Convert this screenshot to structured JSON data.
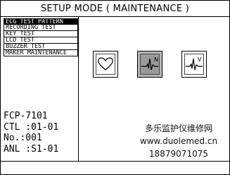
{
  "title": "SETUP MODE ( MAINTENANCE )",
  "menu": {
    "items": [
      {
        "label": "ECG TEST PATTERN",
        "selected": true
      },
      {
        "label": "RECORDING TEST",
        "selected": false
      },
      {
        "label": "KEY TEST",
        "selected": false
      },
      {
        "label": "LCD TEST",
        "selected": false
      },
      {
        "label": "BUZZER TEST",
        "selected": false
      },
      {
        "label": "MAKER MAINTENANCE",
        "selected": false
      }
    ]
  },
  "info": {
    "model": "FCP-7101",
    "ctl": "CTL :01-01",
    "no": "No.:001",
    "anl": "ANL :S1-01"
  },
  "icons": [
    {
      "name": "heart-icon",
      "tag": "",
      "active": false
    },
    {
      "name": "ecg-normal-icon",
      "tag": "N",
      "active": true
    },
    {
      "name": "ecg-v-icon",
      "tag": "V",
      "active": false
    }
  ],
  "dealer": {
    "line1": "多乐监护仪维修网",
    "line2": "www.duolemed.cn",
    "line3": "18879071075"
  }
}
